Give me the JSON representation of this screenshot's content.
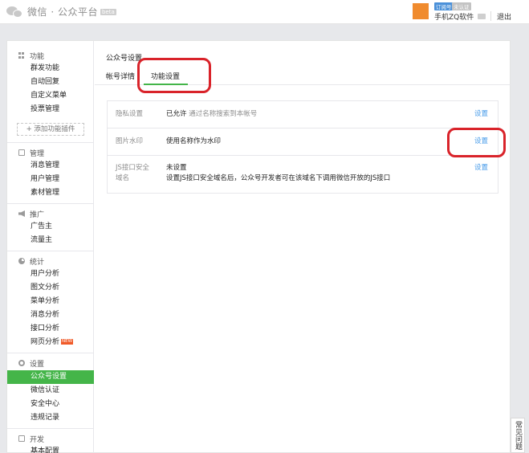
{
  "header": {
    "logo_text": "微信 · 公众平台",
    "beta_label": "beta",
    "account": {
      "subscription_badge": "订阅号",
      "unverified_badge": "未认证",
      "name": "手机ZQ软件",
      "avatar_color": "#f08b2e"
    },
    "logout": "退出"
  },
  "sidebar": {
    "groups": [
      {
        "title": "功能",
        "icon": "grid-icon",
        "items": [
          "群发功能",
          "自动回复",
          "自定义菜单",
          "投票管理"
        ]
      },
      {
        "title": "管理",
        "icon": "manage-icon",
        "items": [
          "消息管理",
          "用户管理",
          "素材管理"
        ]
      },
      {
        "title": "推广",
        "icon": "megaphone-icon",
        "items": [
          "广告主",
          "流量主"
        ]
      },
      {
        "title": "统计",
        "icon": "pie-chart-icon",
        "items": [
          "用户分析",
          "图文分析",
          "菜单分析",
          "消息分析",
          "接口分析",
          "网页分析"
        ]
      },
      {
        "title": "设置",
        "icon": "gear-icon",
        "items": [
          "公众号设置",
          "微信认证",
          "安全中心",
          "违规记录"
        ]
      },
      {
        "title": "开发",
        "icon": "dev-icon",
        "items": [
          "基本配置"
        ]
      }
    ],
    "add_plugin": "+ 添加功能插件",
    "new_tag": "NEW",
    "active_item": "公众号设置"
  },
  "main": {
    "page_title": "公众号设置",
    "tabs": [
      {
        "label": "帐号详情",
        "active": false
      },
      {
        "label": "功能设置",
        "active": true
      }
    ],
    "settings": [
      {
        "label": "隐私设置",
        "value": "已允许",
        "desc": "通过名称搜索到本帐号",
        "action": "设置"
      },
      {
        "label": "图片水印",
        "value": "使用名称作为水印",
        "desc": "",
        "action": "设置"
      },
      {
        "label": "JS接口安全域名",
        "value": "未设置",
        "desc": "设置JS接口安全域名后，公众号开发者可在该域名下调用微信开放的JS接口",
        "action": "设置"
      }
    ]
  },
  "faq": "常见问题",
  "colors": {
    "accent_green": "#44b549",
    "link_blue": "#459ae9",
    "annotation_red": "#d9232a"
  }
}
